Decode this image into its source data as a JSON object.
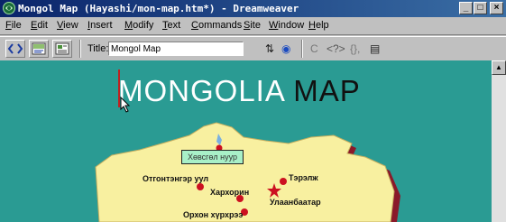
{
  "window": {
    "title": "Mongol Map (Hayashi/mon-map.htm*) - Dreamweaver",
    "buttons": {
      "minimize": "_",
      "maximize": "□",
      "close": "×"
    }
  },
  "menubar": {
    "items": [
      {
        "pre": "",
        "u": "F",
        "post": "ile"
      },
      {
        "pre": "",
        "u": "E",
        "post": "dit"
      },
      {
        "pre": "",
        "u": "V",
        "post": "iew"
      },
      {
        "pre": "",
        "u": "I",
        "post": "nsert"
      },
      {
        "pre": "",
        "u": "M",
        "post": "odify"
      },
      {
        "pre": "",
        "u": "T",
        "post": "ext"
      },
      {
        "pre": "",
        "u": "C",
        "post": "ommands"
      },
      {
        "pre": "",
        "u": "S",
        "post": "ite"
      },
      {
        "pre": "",
        "u": "W",
        "post": "indow"
      },
      {
        "pre": "",
        "u": "H",
        "post": "elp"
      }
    ]
  },
  "toolbar": {
    "title_label": "Title:",
    "title_value": "Mongol Map",
    "icons": [
      "show-code-view-icon",
      "show-code-and-design-icon",
      "show-design-view-icon",
      "file-management-icon",
      "preview-browser-icon",
      "refresh-icon",
      "reference-icon",
      "code-navigation-icon",
      "view-options-icon"
    ],
    "glyphs": {
      "file_mgmt": "⇅",
      "preview": "◉",
      "refresh": "C",
      "reference": "<?>",
      "code_nav": "{},",
      "view_opts": "▤"
    }
  },
  "page": {
    "heading_part1": "MONGOLIA",
    "heading_part2": "MAP",
    "tooltip": "Хөвсгөл нуур",
    "places": [
      {
        "name": "Отгонтэнгэр уул",
        "marker": "dot"
      },
      {
        "name": "Тэрэлж",
        "marker": "dot"
      },
      {
        "name": "Хархорин",
        "marker": "dot"
      },
      {
        "name": "Улаанбаатар",
        "marker": "star"
      },
      {
        "name": "Орхон хүрхрээ",
        "marker": "dot"
      }
    ]
  },
  "colors": {
    "titlebar_start": "#0a246a",
    "titlebar_end": "#3a6ea5",
    "page_background": "#2a9b93",
    "map_fill": "#f8f0a0",
    "map_shadow": "#8a1a2a",
    "marker": "#cc1020",
    "tooltip_bg": "#a8f0c8"
  }
}
